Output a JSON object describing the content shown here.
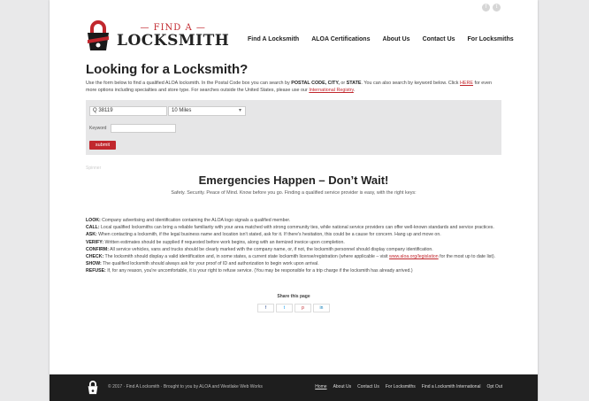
{
  "social": [
    "f",
    "t"
  ],
  "logo": {
    "find": "— FIND A —",
    "locksmith": "LOCKSMITH"
  },
  "nav": [
    "Find A Locksmith",
    "ALOA Certifications",
    "About Us",
    "Contact Us",
    "For Locksmiths"
  ],
  "page": {
    "title": "Looking for a Locksmith?",
    "intro_a": "Use the form below to find a qualified ALOA locksmith.  In the Postal Code box you can search by ",
    "intro_bold": "POSTAL CODE, CITY,",
    "intro_b": " or ",
    "intro_bold2": "STATE",
    "intro_c": ".  You can also search by keyword below.  Click ",
    "intro_link1": "HERE",
    "intro_d": " for even more options including specialties and store type.  For searches outside the United States, please use our ",
    "intro_link2": "International Registry",
    "intro_e": "."
  },
  "form": {
    "postal_value": "Q 38119",
    "radius_value": "10 Miles",
    "keyword_label": "Keyword",
    "keyword_value": "",
    "submit_label": "submit"
  },
  "spacer_text": "Spinner",
  "emergency": {
    "headline": "Emergencies Happen – Don’t Wait!",
    "tagline": "Safety. Security. Peace of Mind. Know before you go. Finding a qualified service provider is easy, with the right keys:"
  },
  "tips": [
    {
      "key": "LOOK:",
      "text": " Company advertising and identification containing the ALOA logo signals a qualified member."
    },
    {
      "key": "CALL:",
      "text": " Local qualified locksmiths can bring a reliable familiarity with your area matched with strong community ties, while national service providers can offer well-known standards and service practices."
    },
    {
      "key": "ASK:",
      "text": " When contacting a locksmith, if the legal business name and location isn't stated, ask for it. If there's hesitation, this could be a cause for concern. Hang up and move on."
    },
    {
      "key": "VERIFY:",
      "text": " Written estimates should be supplied if requested before work begins, along with an itemized invoice upon completion."
    },
    {
      "key": "CONFIRM:",
      "text": " All service vehicles, vans and trucks should be clearly marked with the company name, or, if not, the locksmith personnel should display company identification."
    },
    {
      "key": "CHECK:",
      "text": " The locksmith should display a valid identification and, in some states, a current state locksmith license/registration (where applicable – visit ",
      "link": "www.aloa.org/legislation",
      "after": " for the most up to date list)."
    },
    {
      "key": "SHOW:",
      "text": " The qualified locksmith should always ask for your proof of ID and authorization to begin work upon arrival."
    },
    {
      "key": "REFUSE:",
      "text": " If, for any reason, you're uncomfortable, it is your right to refuse service. (You may be responsible for a trip charge if the locksmith has already arrived.)"
    }
  ],
  "share": {
    "title": "Share this page",
    "buttons": [
      "f",
      "t",
      "p",
      "in"
    ]
  },
  "footer": {
    "copyright": "© 2017 · Find A Locksmith · Brought to you by ALOA and Westlake Web Works",
    "links": [
      "Home",
      "About Us",
      "Contact Us",
      "For Locksmiths",
      "Find a Locksmith International",
      "Opt Out"
    ]
  },
  "colors": {
    "brand_red": "#c1272d",
    "footer_bg": "#1e1e1e",
    "form_bg": "#e6e6e7"
  }
}
